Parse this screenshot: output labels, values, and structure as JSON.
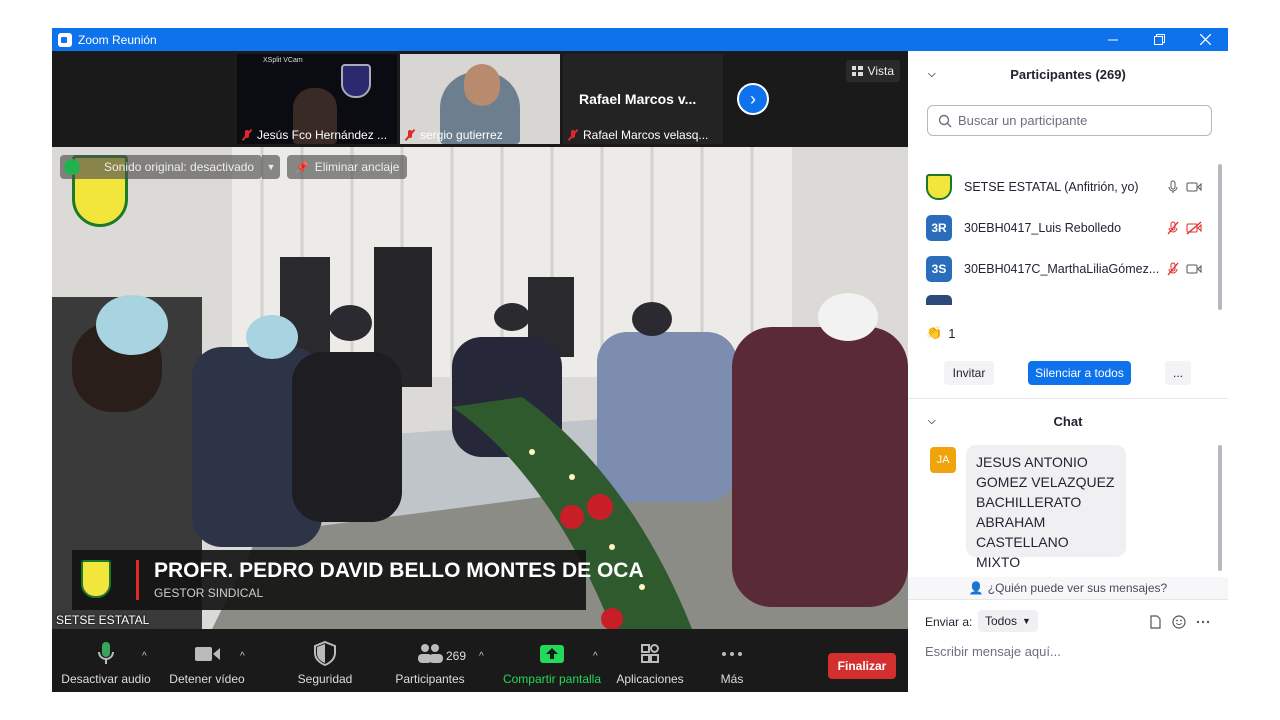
{
  "window": {
    "title": "Zoom Reunión",
    "minimize_icon": "minimize-icon",
    "restore_icon": "restore-icon",
    "close_icon": "close-icon"
  },
  "gallery": {
    "thumbnails": [
      {
        "name": "Jesús Fco Hernández ...",
        "muted": true,
        "overlay_text": "XSplit VCam"
      },
      {
        "name": "sergio gutierrez",
        "muted": true
      },
      {
        "name": "Rafael Marcos velasq...",
        "muted": true,
        "center_text": "Rafael Marcos v..."
      }
    ],
    "view_label": "Vista"
  },
  "main_video": {
    "original_sound_label": "Sonido original: desactivado",
    "unpin_label": "Eliminar anclaje",
    "nameplate_title": "PROFR. PEDRO DAVID BELLO MONTES DE OCA",
    "nameplate_subtitle": "GESTOR SINDICAL",
    "speaker_label": "SETSE ESTATAL"
  },
  "toolbar": {
    "mute_label": "Desactivar audio",
    "video_label": "Detener vídeo",
    "security_label": "Seguridad",
    "participants_label": "Participantes",
    "participants_count": "269",
    "share_label": "Compartir pantalla",
    "apps_label": "Aplicaciones",
    "more_label": "Más",
    "end_label": "Finalizar",
    "colors": {
      "share": "#23d959",
      "end": "#d42f2f"
    }
  },
  "participants_panel": {
    "header": "Participantes (269)",
    "search_placeholder": "Buscar un participante",
    "items": [
      {
        "name": "SETSE ESTATAL (Anfitrión, yo)",
        "initials": "",
        "avatar_color": "#ffffff",
        "mic": "on",
        "video": "on"
      },
      {
        "name": "30EBH0417_Luis Rebolledo",
        "initials": "3R",
        "avatar_color": "#2a6ebb",
        "mic": "muted",
        "video": "off"
      },
      {
        "name": "30EBH0417C_MarthaLiliaGómez...",
        "initials": "3S",
        "avatar_color": "#2a6ebb",
        "mic": "muted",
        "video": "on"
      }
    ],
    "reaction_count": "1",
    "invite_label": "Invitar",
    "mute_all_label": "Silenciar a todos",
    "more_label": "..."
  },
  "chat_panel": {
    "header": "Chat",
    "messages": [
      {
        "initials": "JA",
        "avatar_color": "#f0a30a",
        "lines": [
          "JESUS ANTONIO",
          "GOMEZ VELAZQUEZ",
          "BACHILLERATO",
          "ABRAHAM",
          "CASTELLANO MIXTO"
        ]
      }
    ],
    "visibility_note": "¿Quién puede ver sus mensajes?",
    "send_to_label": "Enviar a:",
    "send_to_value": "Todos",
    "input_placeholder": "Escribir mensaje aquí..."
  }
}
